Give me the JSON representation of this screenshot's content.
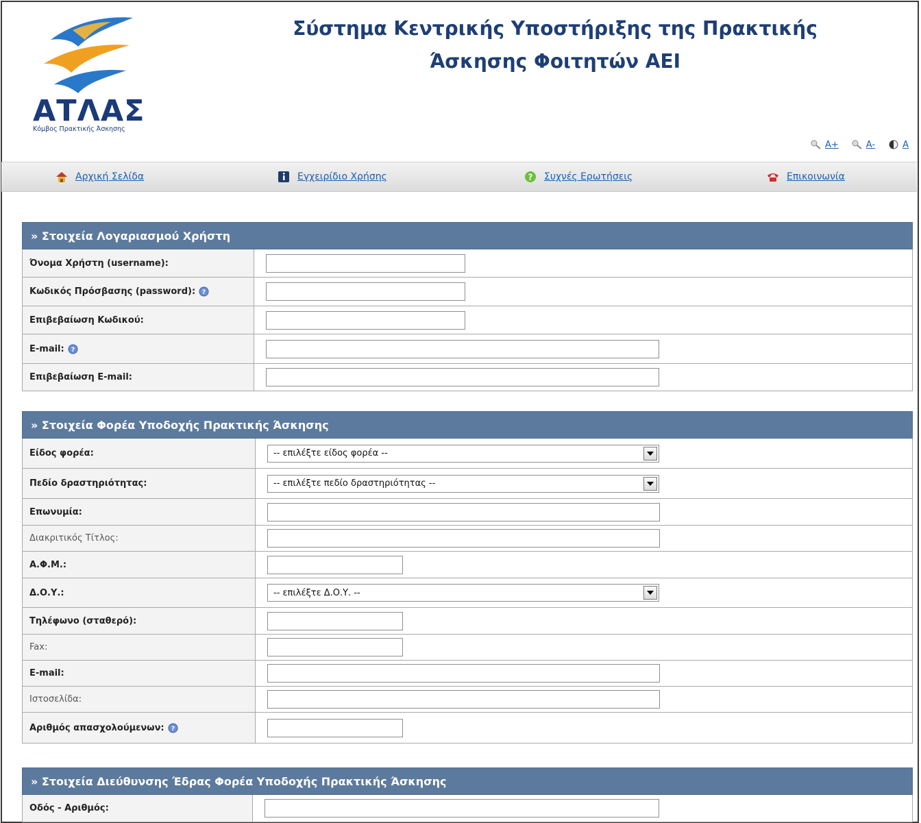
{
  "header": {
    "logo_text": "ΑΤΛΑΣ",
    "logo_subtitle": "Κόμβος Πρακτικής Άσκησης",
    "title_line1": "Σύστημα Κεντρικής Υποστήριξης της Πρακτικής",
    "title_line2": "Άσκησης Φοιτητών ΑΕΙ"
  },
  "accessibility": {
    "increase": "A+",
    "decrease": "A-",
    "contrast": "A"
  },
  "nav": [
    {
      "label": "Αρχική Σελίδα",
      "icon": "home-icon"
    },
    {
      "label": "Εγχειρίδιο Χρήσης",
      "icon": "info-icon"
    },
    {
      "label": "Συχνές Ερωτήσεις",
      "icon": "question-icon"
    },
    {
      "label": "Επικοινωνία",
      "icon": "phone-icon"
    }
  ],
  "sections": [
    {
      "title": "» Στοιχεία Λογαριασμού Χρήστη",
      "fields": [
        {
          "label": "Όνομα Χρήστη (username):",
          "value": ""
        },
        {
          "label": "Κωδικός Πρόσβασης (password):",
          "value": ""
        },
        {
          "label": "Επιβεβαίωση Κωδικού:",
          "value": ""
        },
        {
          "label": "E-mail:",
          "value": ""
        },
        {
          "label": "Επιβεβαίωση E-mail:",
          "value": ""
        }
      ]
    },
    {
      "title": "» Στοιχεία Φορέα Υποδοχής Πρακτικής Άσκησης",
      "fields": [
        {
          "label": "Είδος φορέα:",
          "value": "-- επιλέξτε είδος φορέα --"
        },
        {
          "label": "Πεδίο δραστηριότητας:",
          "value": "-- επιλέξτε πεδίο δραστηριότητας --"
        },
        {
          "label": "Επωνυμία:",
          "value": ""
        },
        {
          "label": "Διακριτικός Τίτλος:",
          "value": ""
        },
        {
          "label": "Α.Φ.Μ.:",
          "value": ""
        },
        {
          "label": "Δ.Ο.Υ.:",
          "value": "-- επιλέξτε Δ.Ο.Υ. --"
        },
        {
          "label": "Τηλέφωνο (σταθερό):",
          "value": ""
        },
        {
          "label": "Fax:",
          "value": ""
        },
        {
          "label": "E-mail:",
          "value": ""
        },
        {
          "label": "Ιστοσελίδα:",
          "value": ""
        },
        {
          "label": "Αριθμός απασχολούμενων:",
          "value": ""
        }
      ]
    },
    {
      "title": "» Στοιχεία Διεύθυνσης Έδρας Φορέα Υποδοχής Πρακτικής Άσκησης",
      "fields": [
        {
          "label": "Οδός - Αριθμός:",
          "value": ""
        }
      ]
    }
  ],
  "colors": {
    "section_header": "#5c7a9d",
    "link": "#1a5fb4",
    "title": "#1e3f74"
  }
}
